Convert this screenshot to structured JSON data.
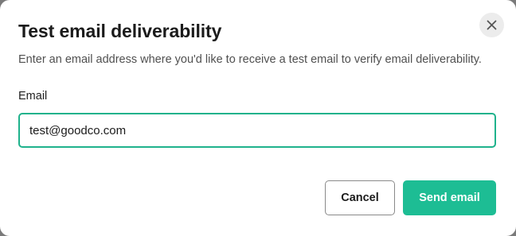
{
  "dialog": {
    "title": "Test email deliverability",
    "description": "Enter an email address where you'd like to receive a test email to verify email deliverability.",
    "close_icon": "close-icon"
  },
  "form": {
    "email_label": "Email",
    "email_value": "test@goodco.com"
  },
  "actions": {
    "cancel_label": "Cancel",
    "send_label": "Send email"
  },
  "colors": {
    "accent": "#1dbd94",
    "input_border": "#1fb28c"
  }
}
